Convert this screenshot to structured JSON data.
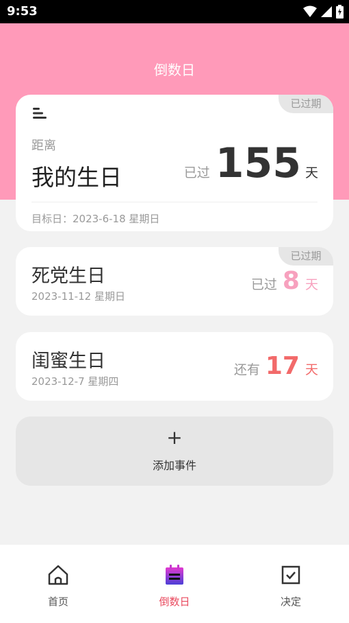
{
  "status_bar": {
    "time": "9:53"
  },
  "header": {
    "title": "倒数日"
  },
  "main_card": {
    "tag": "已过期",
    "subtitle": "距离",
    "name": "我的生日",
    "prefix": "已过",
    "days": "155",
    "unit": "天",
    "target_label": "目标日：2023-6-18 星期日"
  },
  "events": [
    {
      "name": "死党生日",
      "date": "2023-11-12 星期日",
      "tag": "已过期",
      "prefix": "已过",
      "days": "8",
      "unit": "天",
      "color": "#f7a1be"
    },
    {
      "name": "闺蜜生日",
      "date": "2023-12-7 星期四",
      "prefix": "还有",
      "days": "17",
      "unit": "天",
      "color": "#f26a6a"
    }
  ],
  "add_event": {
    "icon": "+",
    "label": "添加事件"
  },
  "nav": [
    {
      "label": "首页",
      "icon": "home-icon"
    },
    {
      "label": "倒数日",
      "icon": "calendar-icon"
    },
    {
      "label": "决定",
      "icon": "checkbox-icon"
    }
  ],
  "colors": {
    "header_bg": "#ff9ab9",
    "active": "#e9495e",
    "passed": "#f7a1be",
    "upcoming": "#f26a6a"
  }
}
